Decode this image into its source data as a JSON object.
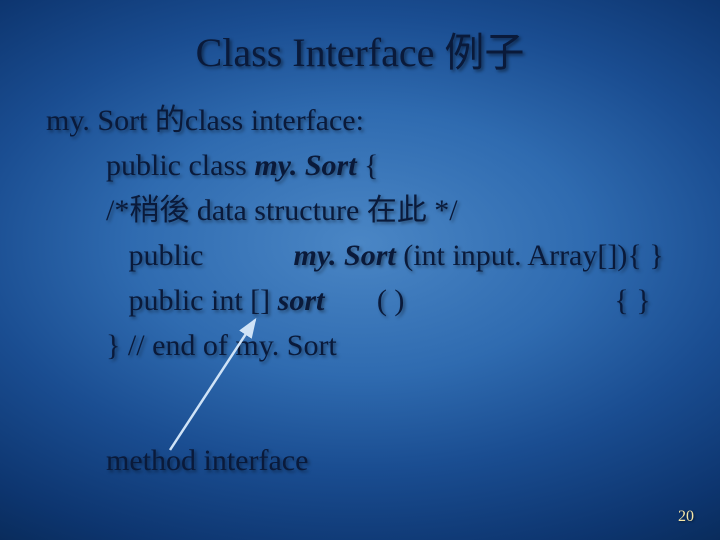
{
  "slide": {
    "title": "Class Interface 例子",
    "intro": "my. Sort 的class interface:",
    "code": {
      "l1_pre": "public class ",
      "l1_em": "my. Sort",
      "l1_post": " {",
      "l2": "/*稍後 data structure 在此 */",
      "l3_pre": "   public            ",
      "l3_em": "my. Sort",
      "l3_post": " (int input. Array[]){ }",
      "l4_pre": "   public int [] ",
      "l4_em": "sort",
      "l4_post": "       ( )                            { }",
      "l5": "} // end of my. Sort"
    },
    "method_label": "method interface",
    "page_number": "20"
  }
}
